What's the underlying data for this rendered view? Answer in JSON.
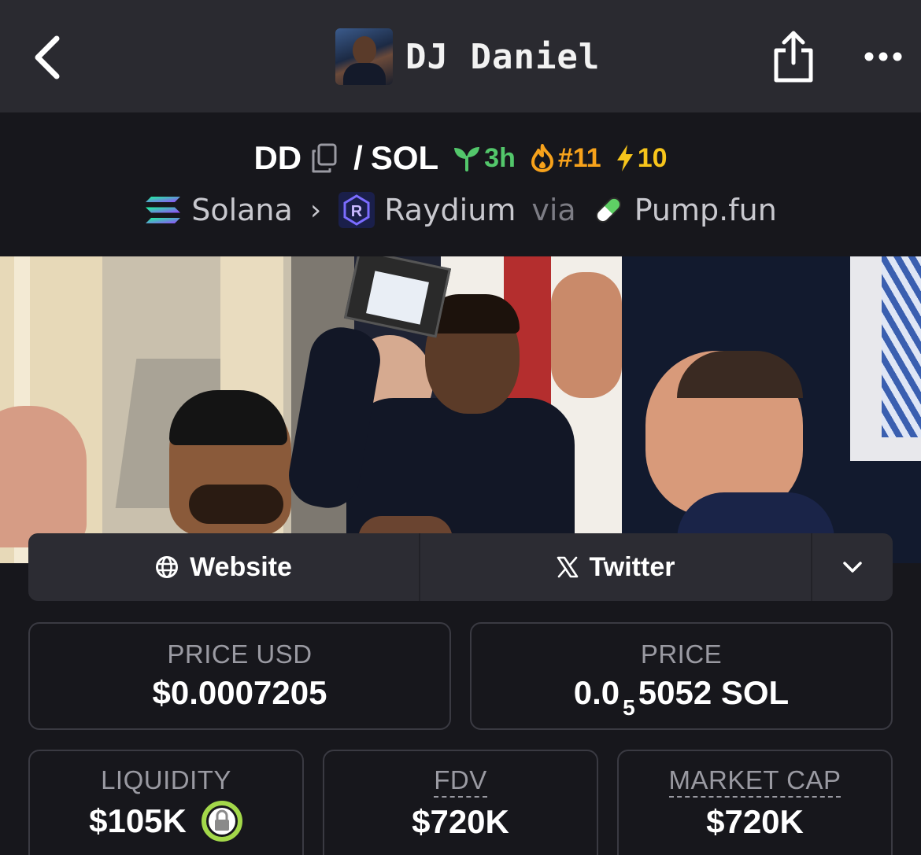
{
  "header": {
    "title": "DJ Daniel",
    "back_icon": "chevron-left-icon",
    "share_icon": "share-icon",
    "more_icon": "more-dots-icon"
  },
  "pair": {
    "base": "DD",
    "separator": "/",
    "quote": "SOL",
    "age": "3h",
    "trending_rank": "#11",
    "boosts": "10",
    "colors": {
      "age": "#53c76b",
      "trending": "#f7a21b",
      "boost": "#f7c51b"
    }
  },
  "chain_path": {
    "chain": "Solana",
    "dex": "Raydium",
    "via": "via",
    "launchpad": "Pump.fun"
  },
  "links": {
    "website": "Website",
    "twitter": "Twitter"
  },
  "stats": {
    "price_usd_label": "PRICE USD",
    "price_usd_value": "$0.0007205",
    "price_label": "PRICE",
    "price_prefix": "0.0",
    "price_sub": "5",
    "price_suffix": "5052 SOL",
    "liquidity_label": "LIQUIDITY",
    "liquidity_value": "$105K",
    "fdv_label": "FDV",
    "fdv_value": "$720K",
    "mcap_label": "MARKET CAP",
    "mcap_value": "$720K"
  }
}
